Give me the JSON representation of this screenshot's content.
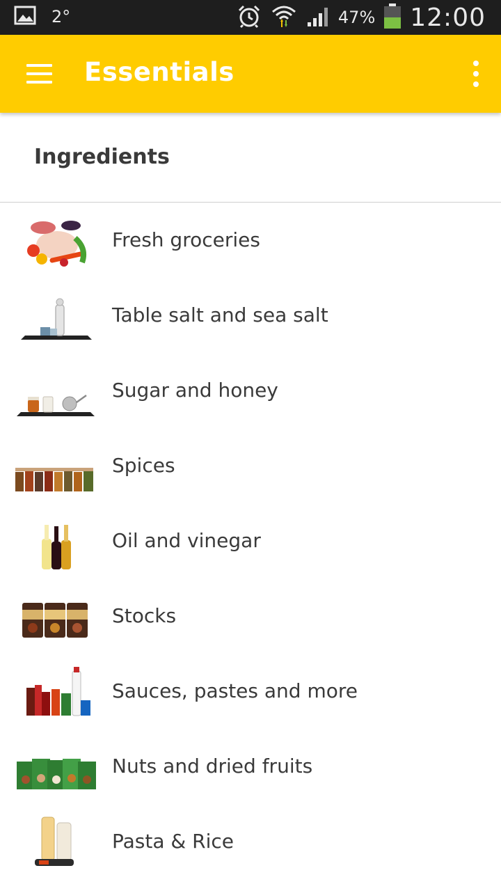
{
  "status_bar": {
    "temperature": "2°",
    "battery_percent": "47%",
    "time": "12:00",
    "icons": [
      "image-icon",
      "alarm-icon",
      "wifi-icon",
      "signal-icon",
      "battery-icon"
    ]
  },
  "app_bar": {
    "title": "Essentials",
    "background_color": "#ffcc00",
    "menu_icon": "hamburger-menu-icon",
    "overflow_icon": "more-vert-icon"
  },
  "section": {
    "title": "Ingredients"
  },
  "items": [
    {
      "label": "Fresh groceries",
      "thumbnail": "fresh-groceries-image"
    },
    {
      "label": "Table salt and sea salt",
      "thumbnail": "salt-image"
    },
    {
      "label": "Sugar and honey",
      "thumbnail": "sugar-honey-image"
    },
    {
      "label": "Spices",
      "thumbnail": "spices-image"
    },
    {
      "label": "Oil and vinegar",
      "thumbnail": "oil-vinegar-image"
    },
    {
      "label": "Stocks",
      "thumbnail": "stocks-image"
    },
    {
      "label": "Sauces, pastes and more",
      "thumbnail": "sauces-image"
    },
    {
      "label": "Nuts and dried fruits",
      "thumbnail": "nuts-image"
    },
    {
      "label": "Pasta & Rice",
      "thumbnail": "pasta-rice-image"
    }
  ]
}
